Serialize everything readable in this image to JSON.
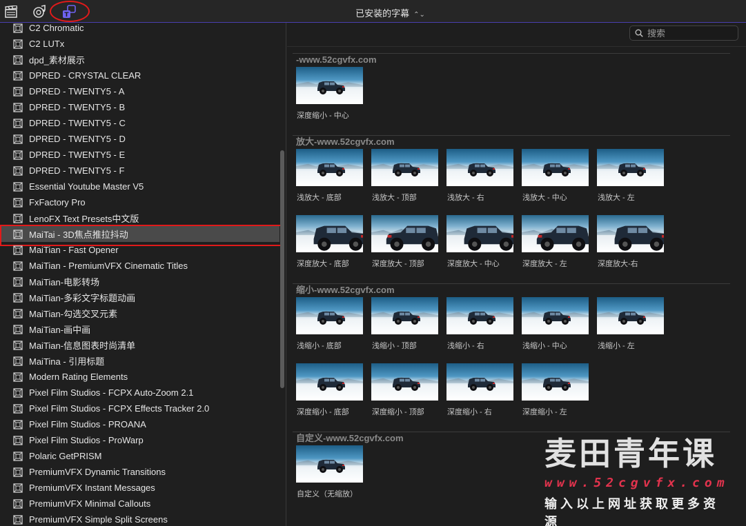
{
  "topbar": {
    "title": "已安装的字幕",
    "tabs": [
      {
        "name": "clapper-icon"
      },
      {
        "name": "music-photo-icon"
      },
      {
        "name": "titles-generators-icon"
      }
    ]
  },
  "sidebar": {
    "selected_index": 13,
    "items": [
      "C2 Chromatic",
      "C2 LUTx",
      "dpd_素材展示",
      "DPRED - CRYSTAL CLEAR",
      "DPRED - TWENTY5 - A",
      "DPRED - TWENTY5 - B",
      "DPRED - TWENTY5 - C",
      "DPRED - TWENTY5 - D",
      "DPRED - TWENTY5 - E",
      "DPRED - TWENTY5 - F",
      "Essential Youtube Master V5",
      "FxFactory Pro",
      "LenoFX Text Presets中文版",
      "MaiTai - 3D焦点推拉抖动",
      "MaiTian - Fast Opener",
      "MaiTian - PremiumVFX Cinematic Titles",
      "MaiTian-电影转场",
      "MaiTian-多彩文字标题动画",
      "MaiTian-勾选交叉元素",
      "MaiTian-画中画",
      "MaiTian-信息图表时尚清单",
      "MaiTina - 引用标题",
      "Modern Rating Elements",
      "Pixel Film Studios - FCPX Auto-Zoom 2.1",
      "Pixel Film Studios - FCPX Effects Tracker 2.0",
      "Pixel Film Studios - PROANA",
      "Pixel Film Studios - ProWarp",
      "Polaric GetPRISM",
      "PremiumVFX Dynamic Transitions",
      "PremiumVFX Instant Messages",
      "PremiumVFX Minimal Callouts",
      "PremiumVFX Simple Split Screens"
    ]
  },
  "search": {
    "placeholder": "搜索",
    "value": ""
  },
  "groups": [
    {
      "title": "-www.52cgvfx.com",
      "rows": [
        [
          "深度缩小 - 中心"
        ]
      ]
    },
    {
      "title": "放大-www.52cgvfx.com",
      "rows": [
        [
          "浅放大 - 底部",
          "浅放大 - 顶部",
          "浅放大 - 右",
          "浅放大 - 中心",
          "浅放大 - 左"
        ],
        [
          "深度放大 - 底部",
          "深度放大 - 顶部",
          "深度放大 - 中心",
          "深度放大 - 左",
          "深度放大-右"
        ]
      ]
    },
    {
      "title": "缩小-www.52cgvfx.com",
      "rows": [
        [
          "浅缩小 - 底部",
          "浅缩小 - 顶部",
          "浅缩小 - 右",
          "浅缩小 - 中心",
          "浅缩小 - 左"
        ],
        [
          "深度缩小 - 底部",
          "深度缩小 - 顶部",
          "深度缩小 - 右",
          "深度缩小 - 左"
        ]
      ]
    },
    {
      "title": "自定义-www.52cgvfx.com",
      "rows": [
        [
          "自定义（无缩放）"
        ]
      ]
    }
  ],
  "watermark": {
    "title": "麦田青年课",
    "url": "www.52cgvfx.com",
    "subtitle": "输入以上网址获取更多资源"
  },
  "colors": {
    "accent": "#5b4dd6",
    "highlight": "#e11a1a",
    "selected_row": "#4a4a4a"
  }
}
